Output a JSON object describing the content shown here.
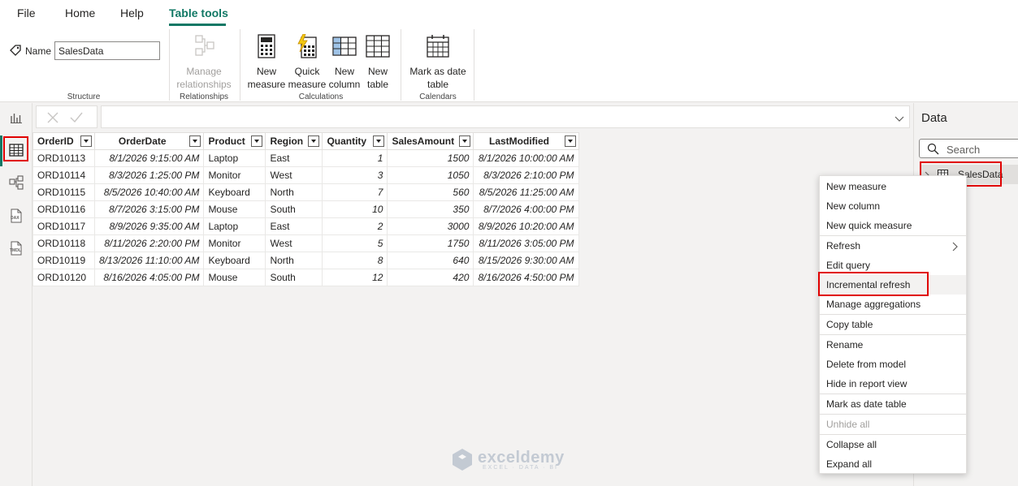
{
  "menu": {
    "file": "File",
    "home": "Home",
    "help": "Help",
    "table_tools": "Table tools"
  },
  "ribbon": {
    "name_label": "Name",
    "name_value": "SalesData",
    "structure_label": "Structure",
    "manage_relationships_line1": "Manage",
    "manage_relationships_line2": "relationships",
    "relationships_label": "Relationships",
    "new_measure_line1": "New",
    "new_measure_line2": "measure",
    "quick_measure_line1": "Quick",
    "quick_measure_line2": "measure",
    "new_column_line1": "New",
    "new_column_line2": "column",
    "new_table_line1": "New",
    "new_table_line2": "table",
    "calculations_label": "Calculations",
    "mark_date_line1": "Mark as date",
    "mark_date_line2": "table",
    "calendars_label": "Calendars"
  },
  "nav_icons": [
    "report-view-icon",
    "table-view-icon",
    "model-view-icon",
    "dax-query-icon",
    "tmdl-view-icon"
  ],
  "nav_labels": {
    "dax": "DAX",
    "tmdl": "TMDL"
  },
  "table": {
    "columns": [
      "OrderID",
      "OrderDate",
      "Product",
      "Region",
      "Quantity",
      "SalesAmount",
      "LastModified"
    ],
    "rows": [
      [
        "ORD10113",
        "8/1/2026 9:15:00 AM",
        "Laptop",
        "East",
        "1",
        "1500",
        "8/1/2026 10:00:00 AM"
      ],
      [
        "ORD10114",
        "8/3/2026 1:25:00 PM",
        "Monitor",
        "West",
        "3",
        "1050",
        "8/3/2026 2:10:00 PM"
      ],
      [
        "ORD10115",
        "8/5/2026 10:40:00 AM",
        "Keyboard",
        "North",
        "7",
        "560",
        "8/5/2026 11:25:00 AM"
      ],
      [
        "ORD10116",
        "8/7/2026 3:15:00 PM",
        "Mouse",
        "South",
        "10",
        "350",
        "8/7/2026 4:00:00 PM"
      ],
      [
        "ORD10117",
        "8/9/2026 9:35:00 AM",
        "Laptop",
        "East",
        "2",
        "3000",
        "8/9/2026 10:20:00 AM"
      ],
      [
        "ORD10118",
        "8/11/2026 2:20:00 PM",
        "Monitor",
        "West",
        "5",
        "1750",
        "8/11/2026 3:05:00 PM"
      ],
      [
        "ORD10119",
        "8/13/2026 11:10:00 AM",
        "Keyboard",
        "North",
        "8",
        "640",
        "8/15/2026 9:30:00 AM"
      ],
      [
        "ORD10120",
        "8/16/2026 4:05:00 PM",
        "Mouse",
        "South",
        "12",
        "420",
        "8/16/2026 4:50:00 PM"
      ]
    ]
  },
  "data_pane": {
    "title": "Data",
    "search_placeholder": "Search",
    "table_name": "SalesData"
  },
  "context_menu": {
    "items": [
      "New measure",
      "New column",
      "New quick measure",
      "Refresh",
      "Edit query",
      "Incremental refresh",
      "Manage aggregations",
      "Copy table",
      "Rename",
      "Delete from model",
      "Hide in report view",
      "Mark as date table",
      "Unhide all",
      "Collapse all",
      "Expand all"
    ]
  },
  "watermark": {
    "name": "exceldemy",
    "tagline": "EXCEL · DATA · BI"
  },
  "colors": {
    "accent": "#117865",
    "highlight_box": "#e00000"
  }
}
